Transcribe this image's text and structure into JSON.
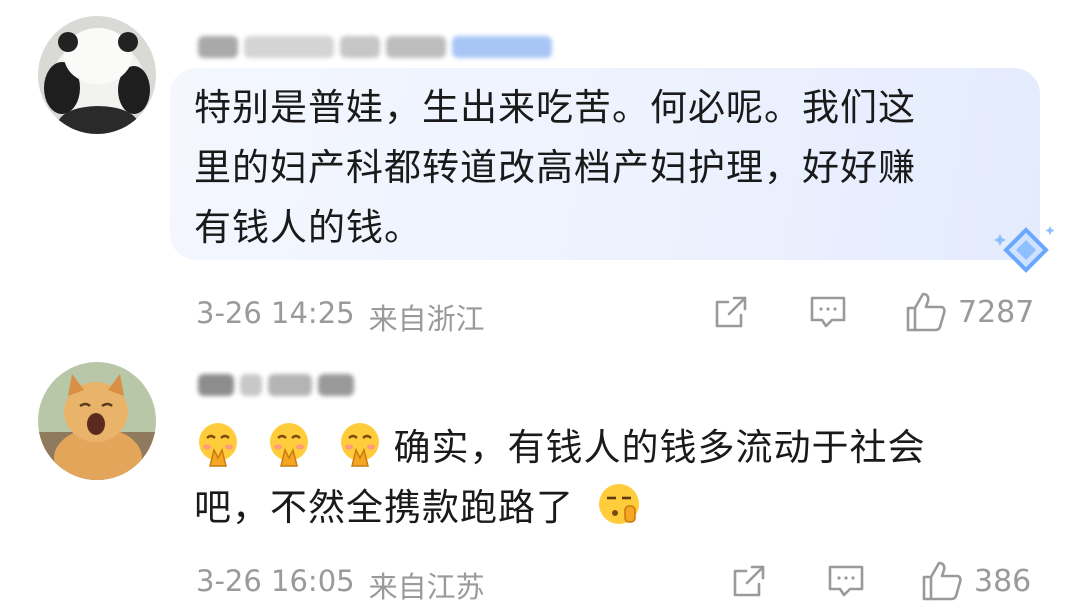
{
  "comments": [
    {
      "username": "",
      "avatar_icon": "panda-avatar-icon",
      "text_lines": [
        "特别是普娃，生出来吃苦。何必呢。我们这",
        "里的妇产科都转道改高档产妇护理，好好赚",
        "有钱人的钱。"
      ],
      "date": "3-26 14:25",
      "location": "来自浙江",
      "likes": "7287",
      "highlighted": true,
      "badge_icon": "diamond-badge-icon"
    },
    {
      "username": "",
      "avatar_icon": "cat-avatar-icon",
      "emojis": [
        "pray-emoji-icon",
        "pray-emoji-icon",
        "pray-emoji-icon"
      ],
      "text_line1": "确实，有钱人的钱多流动于社会",
      "text_line2": "吧，不然全携款跑路了",
      "trailing_emoji": "shush-emoji-icon",
      "date": "3-26 16:05",
      "location": "来自江苏",
      "likes": "386",
      "highlighted": false
    }
  ],
  "icons": {
    "share": "share-icon",
    "reply": "reply-icon",
    "like": "thumbs-up-icon"
  },
  "colors": {
    "bubble": "#edf2fe",
    "meta_text": "#9a9a9a",
    "body_text": "#1a1a1a",
    "badge": "#6aa8ff"
  }
}
